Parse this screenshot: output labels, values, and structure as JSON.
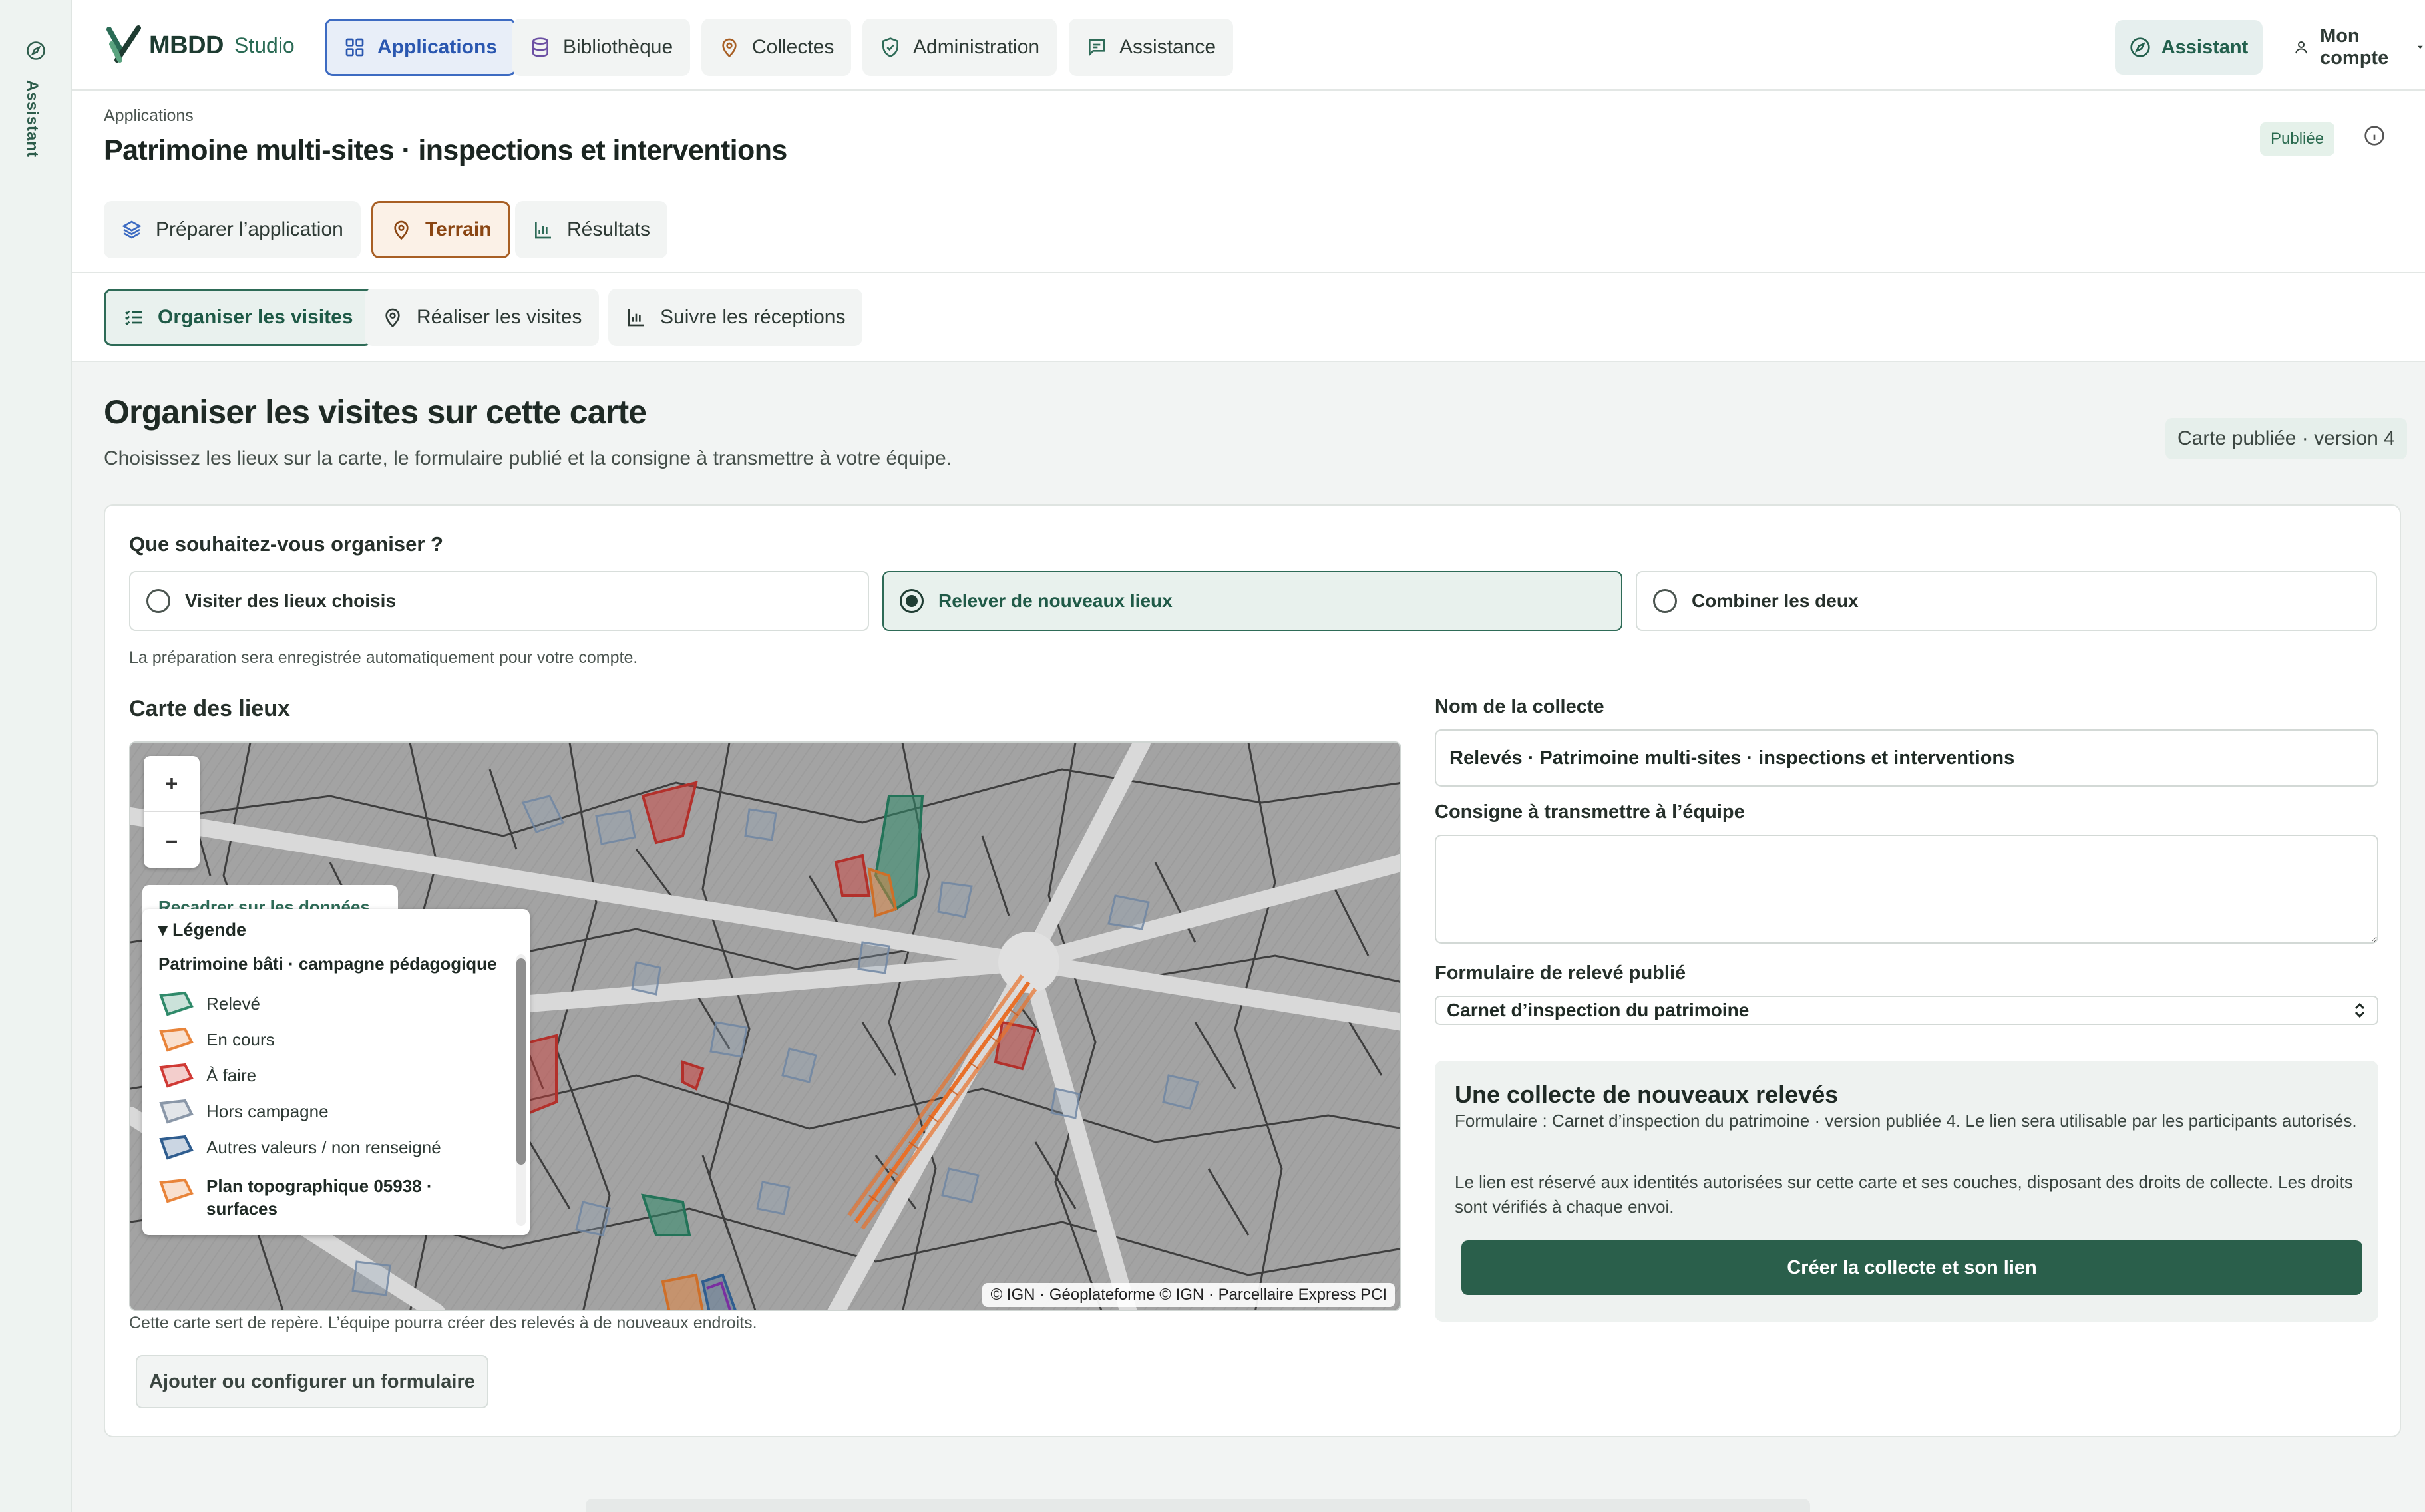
{
  "rail": {
    "label": "Assistant"
  },
  "topbar": {
    "brand": "MBDD",
    "brand_sub": "Studio",
    "nav": [
      {
        "label": "Applications",
        "icon": "grid-icon",
        "active": true
      },
      {
        "label": "Bibliothèque",
        "icon": "database-icon",
        "active": false
      },
      {
        "label": "Collectes",
        "icon": "map-pin-icon",
        "active": false
      },
      {
        "label": "Administration",
        "icon": "shield-check-icon",
        "active": false
      },
      {
        "label": "Assistance",
        "icon": "message-icon",
        "active": false
      }
    ],
    "assistant_label": "Assistant",
    "account_label": "Mon compte"
  },
  "header": {
    "breadcrumb": "Applications",
    "title": "Patrimoine multi-sites · inspections et interventions",
    "status_badge": "Publiée",
    "tabs": [
      {
        "label": "Préparer l’application",
        "icon": "layers-icon",
        "active": false
      },
      {
        "label": "Terrain",
        "icon": "map-pin-icon",
        "active": true
      },
      {
        "label": "Résultats",
        "icon": "bar-chart-icon",
        "active": false
      }
    ]
  },
  "subnav": {
    "tabs": [
      {
        "label": "Organiser les visites",
        "icon": "checklist-icon",
        "active": true
      },
      {
        "label": "Réaliser les visites",
        "icon": "map-pin-icon",
        "active": false
      },
      {
        "label": "Suivre les réceptions",
        "icon": "bar-chart-icon",
        "active": false
      }
    ]
  },
  "page": {
    "title": "Organiser les visites sur cette carte",
    "description": "Choisissez les lieux sur la carte, le formulaire publié et la consigne à transmettre à votre équipe.",
    "version_badge": "Carte publiée · version 4"
  },
  "organize": {
    "question": "Que souhaitez-vous organiser ?",
    "options": [
      {
        "label": "Visiter des lieux choisis",
        "selected": false
      },
      {
        "label": "Relever de nouveaux lieux",
        "selected": true
      },
      {
        "label": "Combiner les deux",
        "selected": false
      }
    ],
    "autosave_note": "La préparation sera enregistrée automatiquement pour votre compte."
  },
  "map": {
    "title": "Carte des lieux",
    "zoom_in": "+",
    "zoom_out": "–",
    "recenter": "Recadrer sur les données",
    "legend": {
      "summary": "▾ Légende",
      "group1": "Patrimoine bâti · campagne pédagogique",
      "items": [
        {
          "label": "Relevé",
          "color": "#2f8a6a"
        },
        {
          "label": "En cours",
          "color": "#e8843a"
        },
        {
          "label": "À faire",
          "color": "#d03a35"
        },
        {
          "label": "Hors campagne",
          "color": "#8a97a8"
        },
        {
          "label": "Autres valeurs / non renseigné",
          "color": "#2f5d8f"
        }
      ],
      "group2": "Plan topographique 05938 · surfaces",
      "group2_color": "#e8843a"
    },
    "attribution": "© IGN · Géoplateforme © IGN · Parcellaire Express PCI",
    "note": "Cette carte sert de repère. L’équipe pourra créer des relevés à de nouveaux endroits."
  },
  "add_form_button": "Ajouter ou configurer un formulaire",
  "form": {
    "name_label": "Nom de la collecte",
    "name_value": "Relevés · Patrimoine multi-sites · inspections et interventions",
    "consigne_label": "Consigne à transmettre à l’équipe",
    "consigne_value": "",
    "form_label": "Formulaire de relevé publié",
    "form_value": "Carnet d’inspection du patrimoine"
  },
  "summary": {
    "title": "Une collecte de nouveaux relevés",
    "p1": "Formulaire : Carnet d’inspection du patrimoine · version publiée 4. Le lien sera utilisable par les participants autorisés.",
    "p2": "Le lien est réservé aux identités autorisées sur cette carte et ses couches, disposant des droits de collecte. Les droits sont vérifiés à chaque envoi.",
    "button": "Créer la collecte et son lien"
  }
}
